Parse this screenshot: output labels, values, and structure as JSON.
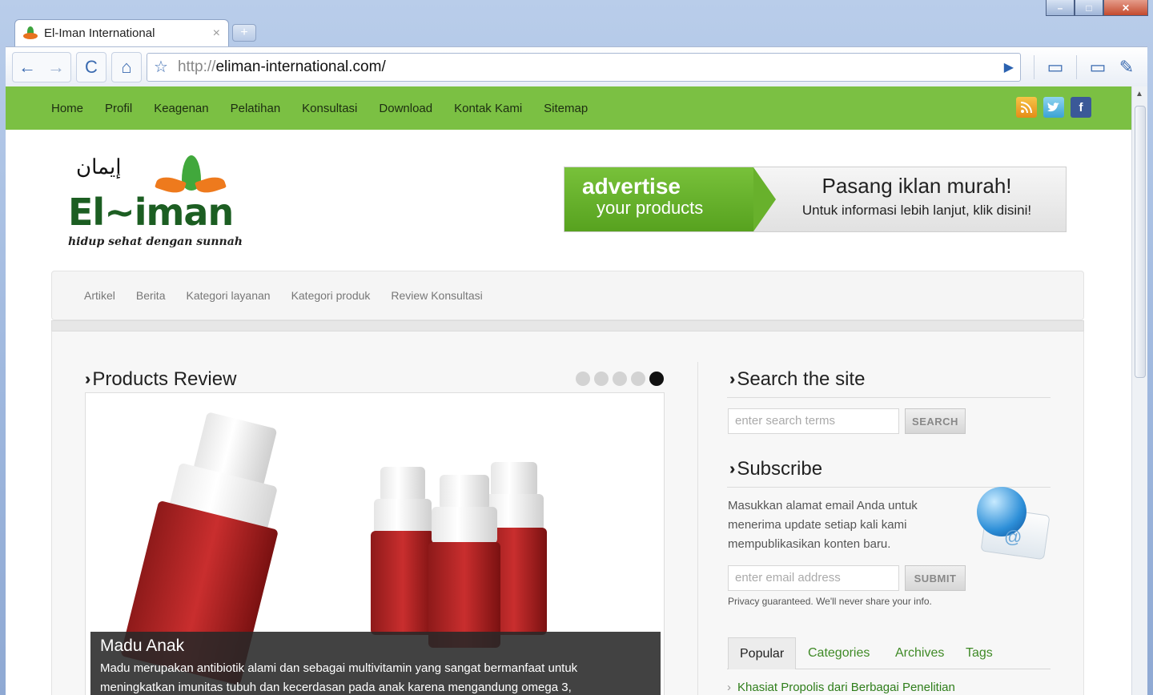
{
  "browser": {
    "tab_title": "El-Iman International",
    "tab_close": "×",
    "new_tab": "+",
    "url_protocol": "http://",
    "url_host": "eliman-international.com/",
    "back_icon": "←",
    "forward_icon": "→",
    "reload_icon": "C",
    "home_icon": "⌂",
    "star_icon": "☆",
    "go_icon": "▶",
    "page_icon": "▭",
    "tools_icon": "✎"
  },
  "topnav": {
    "items": [
      "Home",
      "Profil",
      "Keagenan",
      "Pelatihan",
      "Konsultasi",
      "Download",
      "Kontak Kami",
      "Sitemap"
    ],
    "social": {
      "rss": "",
      "twitter": "",
      "facebook": "f"
    }
  },
  "logo": {
    "arabic": "إيمان",
    "name": "El~iman",
    "tagline": "hidup sehat dengan sunnah"
  },
  "ad": {
    "line1": "advertise",
    "line2": "your products",
    "headline": "Pasang iklan murah!",
    "subline": "Untuk informasi lebih lanjut, klik disini!"
  },
  "subnav": {
    "items": [
      "Artikel",
      "Berita",
      "Kategori layanan",
      "Kategori produk",
      "Review Konsultasi"
    ]
  },
  "products": {
    "title": "Products Review",
    "dots_total": 5,
    "dots_active_index": 4,
    "caption_title": "Madu Anak",
    "caption_text_1": "Madu merupakan antibiotik alami dan sebagai multivitamin yang sangat bermanfaat untuk",
    "caption_text_2": "meningkatkan imunitas tubuh dan kecerdasan pada anak karena mengandung omega 3,"
  },
  "search": {
    "title": "Search the site",
    "placeholder": "enter search terms",
    "button": "SEARCH"
  },
  "subscribe": {
    "title": "Subscribe",
    "text_1": "Masukkan alamat email Anda untuk",
    "text_2": "menerima update setiap kali kami",
    "text_3": "mempublikasikan konten baru.",
    "placeholder": "enter email address",
    "button": "SUBMIT",
    "privacy": "Privacy guaranteed. We'll never share your info."
  },
  "widget_tabs": {
    "items": [
      "Popular",
      "Categories",
      "Archives",
      "Tags"
    ],
    "first_post": "Khasiat Propolis dari Berbagai Penelitian"
  }
}
